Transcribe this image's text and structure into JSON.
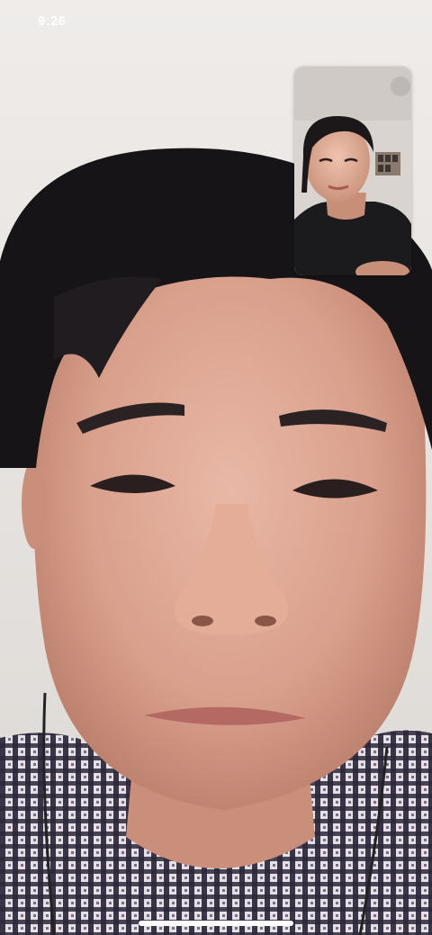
{
  "status_bar": {
    "time": "9:26"
  },
  "call": {
    "remote_video_icon": "person-video-icon",
    "local_preview_icon": "self-view-video-icon"
  },
  "colors": {
    "background": "#e9e6e3",
    "home_indicator": "#ffffff"
  }
}
